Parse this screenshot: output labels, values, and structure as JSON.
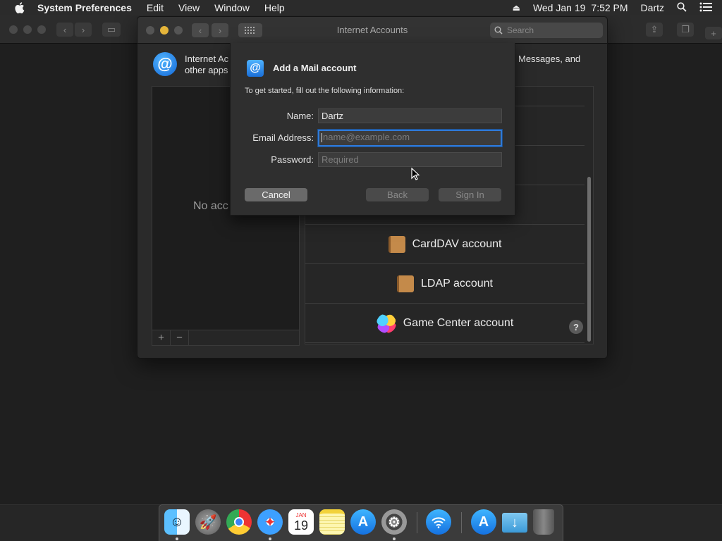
{
  "menubar": {
    "app_name": "System Preferences",
    "items": [
      "Edit",
      "View",
      "Window",
      "Help"
    ],
    "date": "Wed Jan 19",
    "time": "7:52 PM",
    "user": "Dartz"
  },
  "window": {
    "title": "Internet Accounts",
    "search_placeholder": "Search",
    "header_left": "Internet Ac",
    "header_left_line2": "other apps",
    "header_right": "Messages, and",
    "empty_state": "No acc",
    "list_add": "+",
    "list_remove": "−",
    "help": "?"
  },
  "providers": [
    {
      "label": "CardDAV account",
      "icon": "contacts-book-icon",
      "color": "#c48a4a"
    },
    {
      "label": "LDAP account",
      "icon": "contacts-book-icon",
      "color": "#c48a4a"
    },
    {
      "label": "Game Center account",
      "icon": "game-center-icon",
      "color": "#e04a8a"
    }
  ],
  "sheet": {
    "title": "Add a Mail account",
    "intro": "To get started, fill out the following information:",
    "name_label": "Name:",
    "name_value": "Dartz",
    "email_label": "Email Address:",
    "email_placeholder": "name@example.com",
    "password_label": "Password:",
    "password_placeholder": "Required",
    "cancel": "Cancel",
    "back": "Back",
    "sign_in": "Sign In"
  },
  "dock": {
    "calendar_month": "JAN",
    "calendar_day": "19"
  },
  "colors": {
    "accent": "#2f7ad8",
    "background": "#1f1f1f"
  }
}
